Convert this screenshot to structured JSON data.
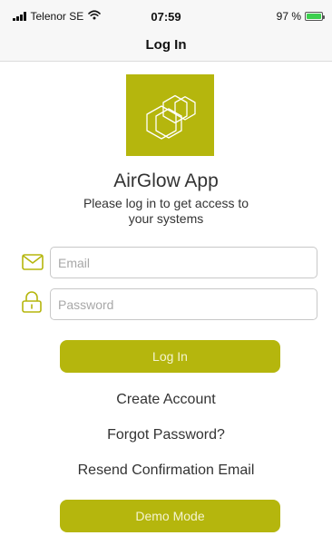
{
  "status_bar": {
    "carrier": "Telenor SE",
    "time": "07:59",
    "battery": "97 %",
    "battery_level": 0.97,
    "icons": [
      "signal-icon",
      "wifi-icon",
      "battery-icon"
    ]
  },
  "nav": {
    "title": "Log In"
  },
  "app": {
    "name": "AirGlow App",
    "subtitle": "Please log in to get access to your systems",
    "logo_icon": "hexagon-cluster-logo"
  },
  "form": {
    "email": {
      "placeholder": "Email",
      "value": "",
      "icon": "envelope-icon"
    },
    "password": {
      "placeholder": "Password",
      "value": "",
      "icon": "lock-icon"
    }
  },
  "actions": {
    "login": "Log In",
    "create_account": "Create Account",
    "forgot_password": "Forgot Password?",
    "resend_confirmation": "Resend Confirmation Email",
    "demo_mode": "Demo Mode"
  },
  "colors": {
    "accent": "#b5b60d",
    "button_text": "#f4f4d0",
    "bar_background": "#f7f7f7"
  }
}
